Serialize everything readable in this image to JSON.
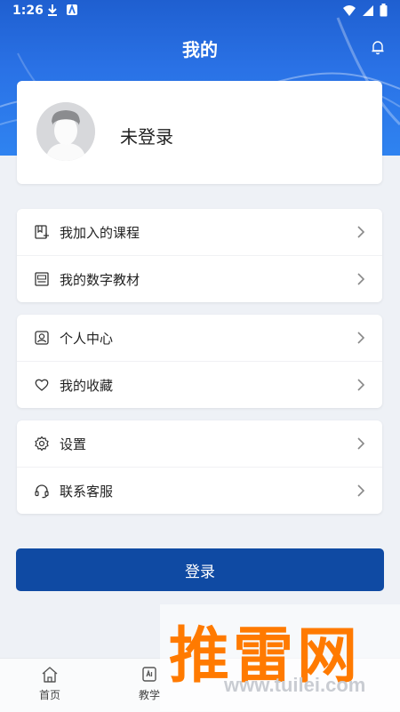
{
  "status_bar": {
    "time": "1:26"
  },
  "header": {
    "title": "我的"
  },
  "profile": {
    "name": "未登录"
  },
  "menu_groups": [
    {
      "items": [
        {
          "label": "我加入的课程",
          "icon": "course-icon"
        },
        {
          "label": "我的数字教材",
          "icon": "ebook-icon"
        }
      ]
    },
    {
      "items": [
        {
          "label": "个人中心",
          "icon": "person-icon"
        },
        {
          "label": "我的收藏",
          "icon": "heart-icon"
        }
      ]
    },
    {
      "items": [
        {
          "label": "设置",
          "icon": "gear-icon"
        },
        {
          "label": "联系客服",
          "icon": "headset-icon"
        }
      ]
    }
  ],
  "login_button": {
    "label": "登录"
  },
  "tabbar": {
    "tabs": [
      {
        "label": "首页",
        "icon": "home-icon"
      },
      {
        "label": "教学",
        "icon": "teaching-icon"
      }
    ]
  },
  "watermark": {
    "brand": "推雷网",
    "url": "www.tuilei.com"
  },
  "colors": {
    "primary": "#0f4aa3",
    "header_blue": "#2a72e6",
    "watermark_orange": "#ff7a00"
  }
}
